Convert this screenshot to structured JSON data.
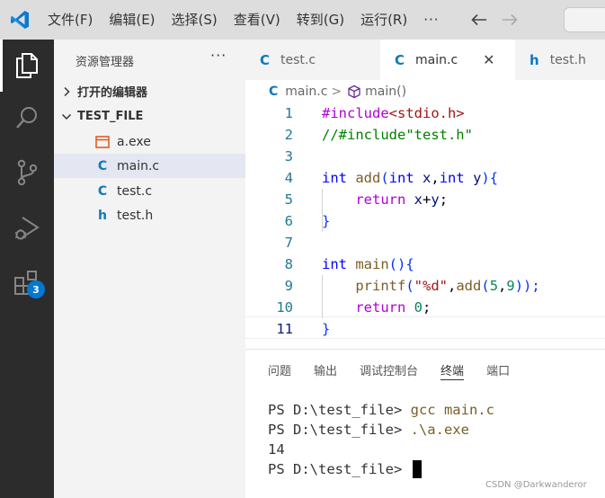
{
  "titlebar": {
    "menu": [
      "文件(F)",
      "编辑(E)",
      "选择(S)",
      "查看(V)",
      "转到(G)",
      "运行(R)",
      "···"
    ]
  },
  "activitybar": {
    "items": [
      "explorer-icon",
      "search-icon",
      "source-control-icon",
      "run-debug-icon",
      "extensions-icon"
    ],
    "extensions_badge": "3"
  },
  "sidebar": {
    "title": "资源管理器",
    "more": "···",
    "open_editors_label": "打开的编辑器",
    "folder_label": "TEST_FILE",
    "files": [
      {
        "icon": "exe-file-icon",
        "glyph": "",
        "name": "a.exe"
      },
      {
        "icon": "c-file-icon",
        "glyph": "C",
        "name": "main.c"
      },
      {
        "icon": "c-file-icon",
        "glyph": "C",
        "name": "test.c"
      },
      {
        "icon": "h-file-icon",
        "glyph": "h",
        "name": "test.h"
      }
    ]
  },
  "tabs": [
    {
      "glyph": "C",
      "label": "test.c"
    },
    {
      "glyph": "C",
      "label": "main.c",
      "close": "✕"
    },
    {
      "glyph": "h",
      "label": "test.h"
    }
  ],
  "breadcrumb": {
    "file_glyph": "C",
    "file": "main.c",
    "sep": ">",
    "symbol": "main()"
  },
  "code": {
    "line_numbers": [
      "1",
      "2",
      "3",
      "4",
      "5",
      "6",
      "7",
      "8",
      "9",
      "10",
      "11"
    ],
    "l1_pre": "#include",
    "l1_inc": "<stdio.h>",
    "l2": "//#include\"test.h\"",
    "l4_int": "int",
    "l4_add": "add",
    "l4_open": "(",
    "l4_int2": "int",
    "l4_x": "x",
    "l4_comma": ",",
    "l4_int3": "int",
    "l4_y": "y",
    "l4_close": "){",
    "l5_ret": "return",
    "l5_x": "x",
    "l5_plus": "+",
    "l5_y": "y",
    "l5_semi": ";",
    "l6": "}",
    "l8_int": "int",
    "l8_main": "main",
    "l8_rest": "(){",
    "l9_printf": "printf",
    "l9_open": "(",
    "l9_str": "\"%d\"",
    "l9_comma": ",",
    "l9_add": "add",
    "l9_open2": "(",
    "l9_5": "5",
    "l9_comma2": ",",
    "l9_9": "9",
    "l9_close": "));",
    "l10_ret": "return",
    "l10_0": "0",
    "l10_semi": ";",
    "l11": "}"
  },
  "panel": {
    "tabs": [
      "问题",
      "输出",
      "调试控制台",
      "终端",
      "端口"
    ],
    "terminal": [
      {
        "prompt": "PS D:\\test_file> ",
        "cmd": "gcc main.c"
      },
      {
        "prompt": "PS D:\\test_file> ",
        "cmd": ".\\a.exe"
      },
      {
        "prompt": "14",
        "cmd": ""
      },
      {
        "prompt": "PS D:\\test_file> ",
        "cmd": ""
      }
    ]
  },
  "watermark": "CSDN @Darkwanderor",
  "colors": {
    "accent": "#0078d4",
    "activitybar": "#2c2c2c",
    "titlebar": "#dddddd",
    "sidebar": "#f3f3f3"
  }
}
